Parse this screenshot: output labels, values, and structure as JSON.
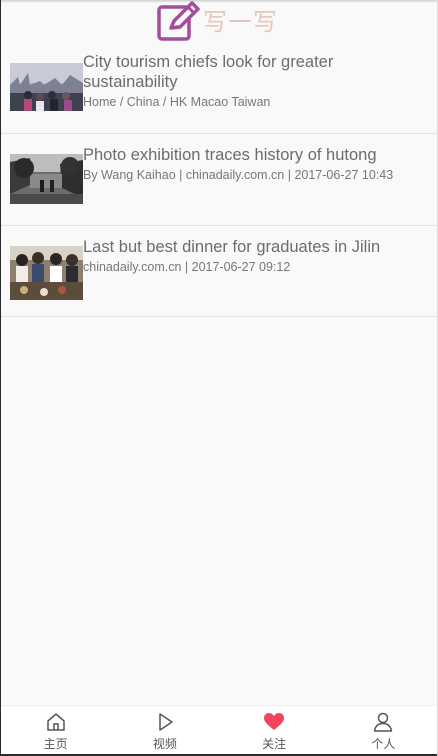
{
  "header": {
    "logo_icon": "edit-pen-icon",
    "logo_text": "写一写",
    "logo_color": "#a14f9b",
    "logo_text_color": "#e6c6bd"
  },
  "news": [
    {
      "title": "City tourism chiefs look for greater sustainability",
      "meta": "Home / China / HK Macao Taiwan"
    },
    {
      "title": "Photo exhibition traces history of hutong",
      "meta": "By Wang Kaihao | chinadaily.com.cn | 2017-06-27 10:43"
    },
    {
      "title": "Last but best dinner for graduates in Jilin",
      "meta": "chinadaily.com.cn | 2017-06-27 09:12"
    }
  ],
  "nav": [
    {
      "label": "主页",
      "icon": "home-icon"
    },
    {
      "label": "视频",
      "icon": "play-icon"
    },
    {
      "label": "关注",
      "icon": "heart-icon",
      "active_color": "#f2445a"
    },
    {
      "label": "个人",
      "icon": "person-icon"
    }
  ]
}
